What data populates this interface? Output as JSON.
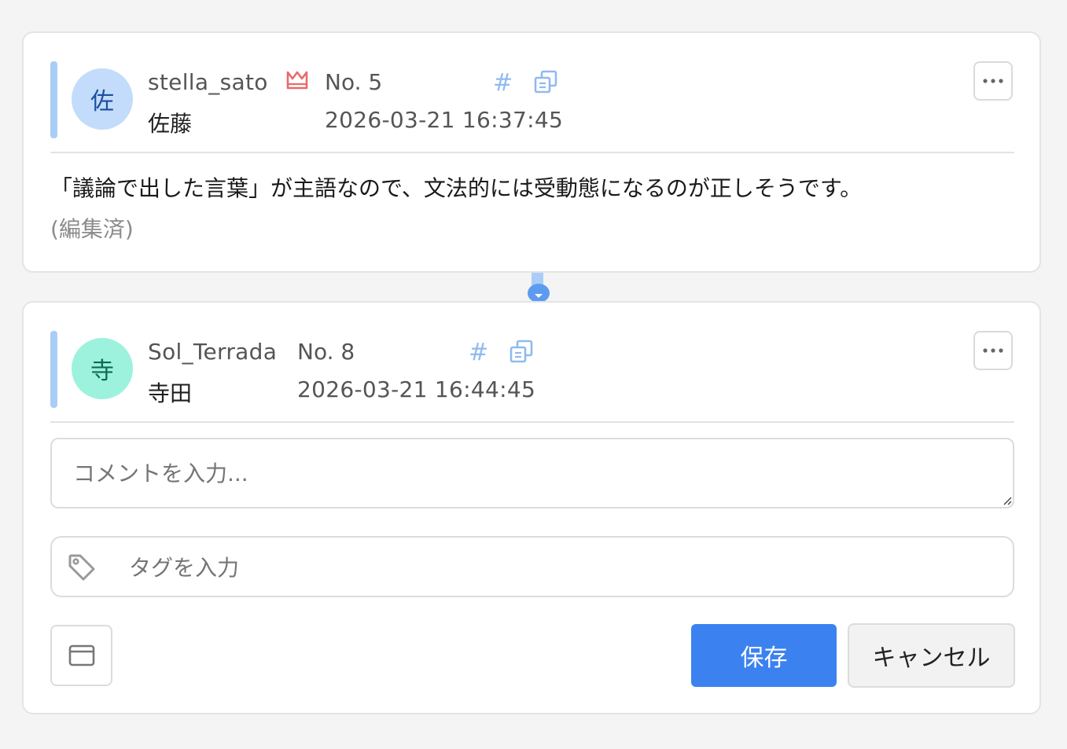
{
  "colors": {
    "accent_blue": "#3b82f0",
    "accent_bar": "#a9cdf7",
    "crown": "#e86b6b",
    "icon_blue": "#8fbaf2"
  },
  "comments": [
    {
      "avatar_char": "佐",
      "avatar_bg": "#c3dcfb",
      "avatar_fg": "#1a4fa0",
      "username": "stella_sato",
      "display_name": "佐藤",
      "badge_icon": "crown-icon",
      "post_no": "No. 5",
      "timestamp": "2026-03-21 16:37:45",
      "body": "「議論で出した言葉」が主語なので、文法的には受動態になるのが正しそうです。",
      "edited_label": "(編集済)"
    },
    {
      "avatar_char": "寺",
      "avatar_bg": "#9df2dd",
      "avatar_fg": "#0d6b55",
      "username": "Sol_Terrada",
      "display_name": "寺田",
      "post_no": "No. 8",
      "timestamp": "2026-03-21 16:44:45"
    }
  ],
  "editor": {
    "comment_placeholder": "コメントを入力...",
    "tag_placeholder": "タグを入力",
    "save_label": "保存",
    "cancel_label": "キャンセル"
  }
}
